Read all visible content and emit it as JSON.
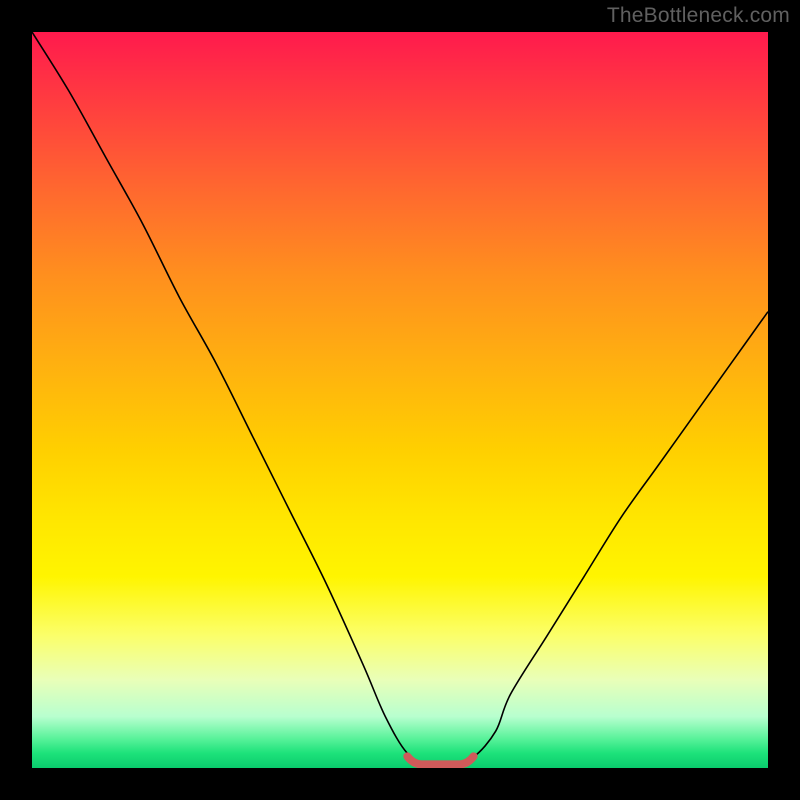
{
  "watermark": "TheBottleneck.com",
  "colors": {
    "frame_bg": "#000000",
    "curve": "#000000",
    "marker": "#d05a5a",
    "gradient_top": "#ff1a4d",
    "gradient_bottom": "#0acb6d"
  },
  "chart_data": {
    "type": "line",
    "title": "",
    "xlabel": "",
    "ylabel": "",
    "xlim": [
      0,
      100
    ],
    "ylim": [
      0,
      100
    ],
    "annotations": [
      {
        "text": "TheBottleneck.com",
        "position": "top-right"
      }
    ],
    "series": [
      {
        "name": "bottleneck-curve",
        "x": [
          0,
          5,
          10,
          15,
          20,
          25,
          30,
          35,
          40,
          45,
          48,
          51,
          54,
          57,
          60,
          63,
          65,
          70,
          75,
          80,
          85,
          90,
          95,
          100
        ],
        "y": [
          100,
          92,
          83,
          74,
          64,
          55,
          45,
          35,
          25,
          14,
          7,
          2,
          0.5,
          0.5,
          1.5,
          5,
          10,
          18,
          26,
          34,
          41,
          48,
          55,
          62
        ]
      }
    ],
    "minimum_band": {
      "x_start": 51,
      "x_end": 60,
      "y": 0.5
    }
  }
}
